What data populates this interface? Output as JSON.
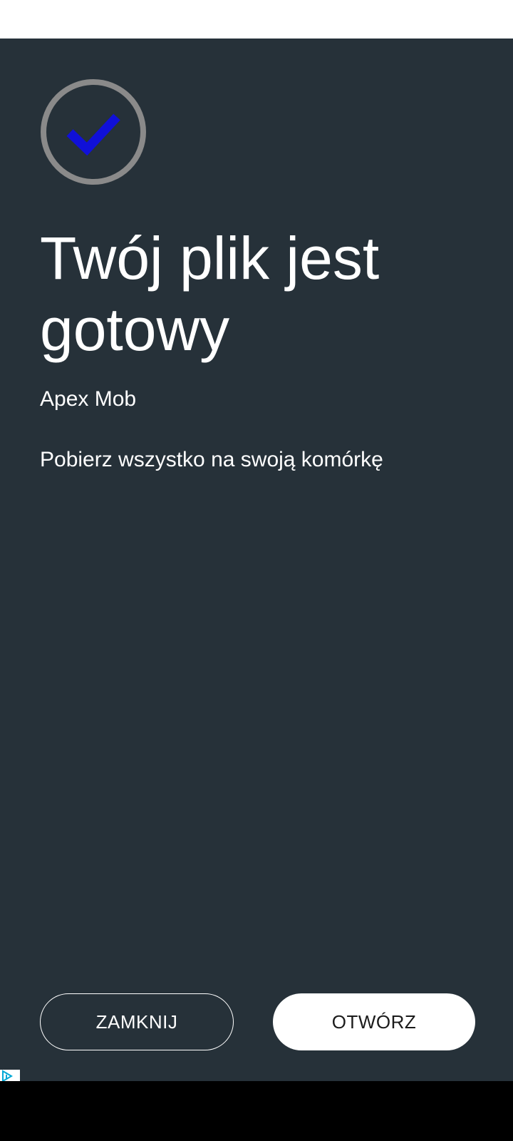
{
  "dialog": {
    "title": "Twój plik jest gotowy",
    "app_name": "Apex Mob",
    "subtitle": "Pobierz wszystko na swoją komórkę",
    "icon": "check-circle-icon",
    "check_color": "#1010d8",
    "ring_color": "#8a8a8a"
  },
  "buttons": {
    "close_label": "ZAMKNIJ",
    "open_label": "OTWÓRZ"
  },
  "ad": {
    "icon": "ad-choices-icon"
  }
}
